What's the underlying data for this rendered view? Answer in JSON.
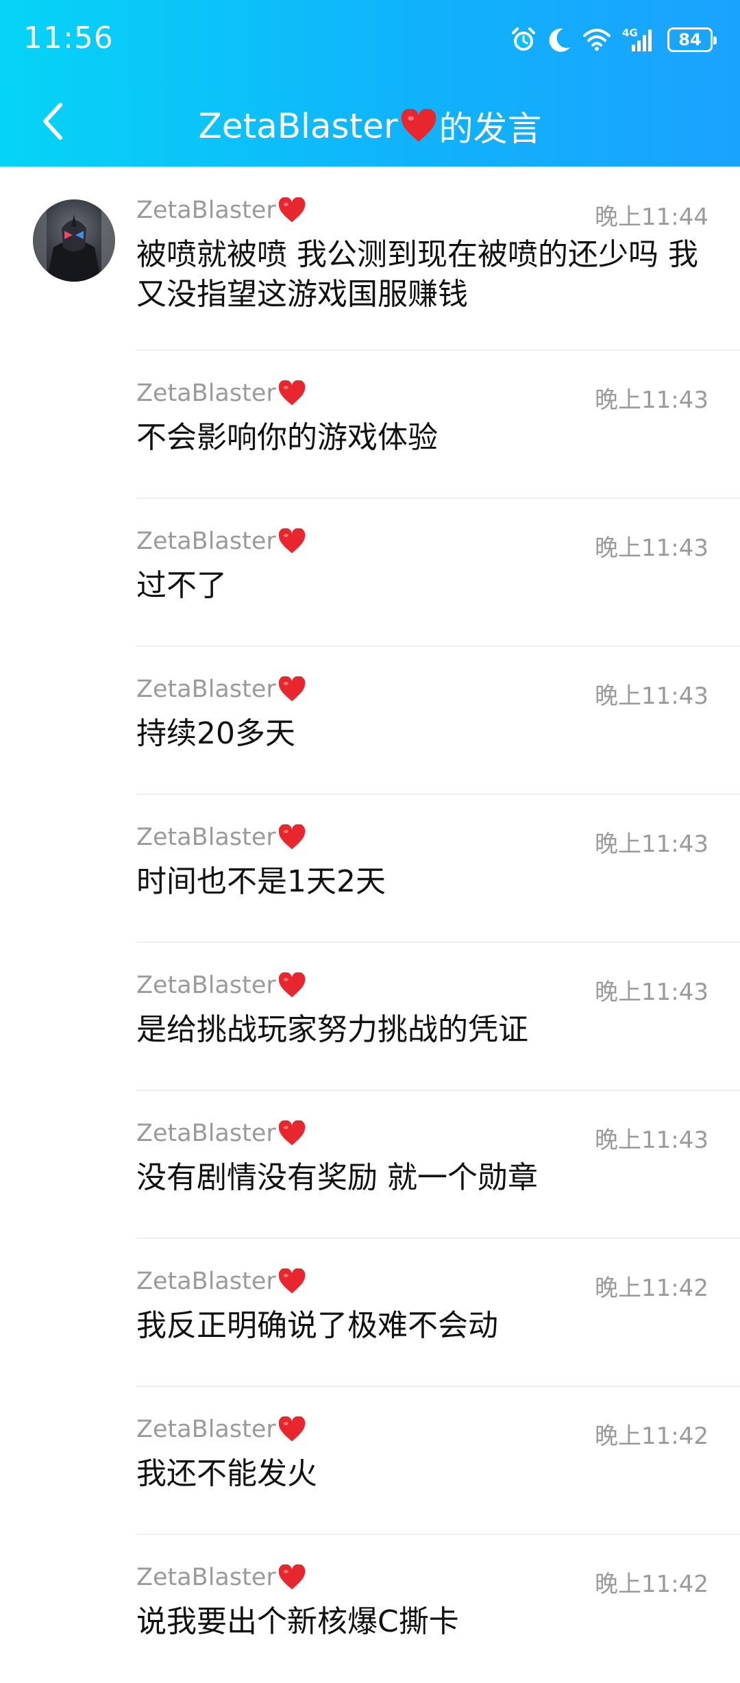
{
  "status_bar": {
    "time": "11:56",
    "icons": [
      "alarm-icon",
      "do-not-disturb-moon-icon",
      "wifi-icon",
      "signal-4g-icon"
    ],
    "network": "4G",
    "battery": "84"
  },
  "header": {
    "title_name": "ZetaBlaster",
    "title_suffix": "的发言",
    "back_icon": "chevron-left-icon",
    "gradient": [
      "#06d4f6",
      "#1aa2ff"
    ]
  },
  "messages": [
    {
      "sender": "ZetaBlaster",
      "time": "晚上11:44",
      "text": "被喷就被喷 我公测到现在被喷的还少吗 我又没指望这游戏国服赚钱"
    },
    {
      "sender": "ZetaBlaster",
      "time": "晚上11:43",
      "text": "不会影响你的游戏体验"
    },
    {
      "sender": "ZetaBlaster",
      "time": "晚上11:43",
      "text": "过不了"
    },
    {
      "sender": "ZetaBlaster",
      "time": "晚上11:43",
      "text": "持续20多天"
    },
    {
      "sender": "ZetaBlaster",
      "time": "晚上11:43",
      "text": "时间也不是1天2天"
    },
    {
      "sender": "ZetaBlaster",
      "time": "晚上11:43",
      "text": "是给挑战玩家努力挑战的凭证"
    },
    {
      "sender": "ZetaBlaster",
      "time": "晚上11:43",
      "text": "没有剧情没有奖励 就一个勋章"
    },
    {
      "sender": "ZetaBlaster",
      "time": "晚上11:42",
      "text": "我反正明确说了极难不会动"
    },
    {
      "sender": "ZetaBlaster",
      "time": "晚上11:42",
      "text": "我还不能发火"
    },
    {
      "sender": "ZetaBlaster",
      "time": "晚上11:42",
      "text": "说我要出个新核爆C撕卡"
    }
  ],
  "colors": {
    "heart": "#e8262d",
    "meta_text": "#9a9a9a",
    "body_text": "#111111"
  }
}
